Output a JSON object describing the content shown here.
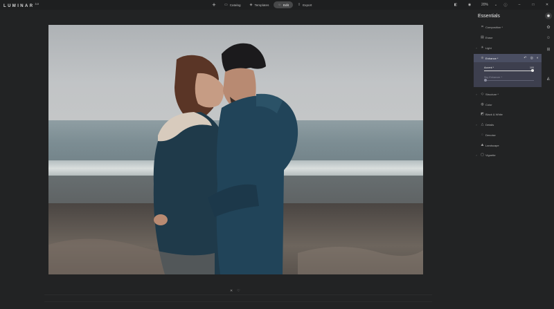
{
  "app": {
    "logo_text": "LUMINAR",
    "logo_version": "3.0"
  },
  "topnav": {
    "add_icon": "plus",
    "items": [
      {
        "label": "Catalog",
        "icon": "catalog-icon"
      },
      {
        "label": "Templates",
        "icon": "templates-icon"
      },
      {
        "label": "Edit",
        "icon": "edit-icon",
        "active": true
      },
      {
        "label": "Export",
        "icon": "export-icon"
      }
    ]
  },
  "topright": {
    "zoom": "20%"
  },
  "bottom": {
    "reject_glyph": "✕",
    "favorite_glyph": "♡"
  },
  "panel": {
    "title": "Essentials",
    "tools": [
      {
        "label": "Composition *",
        "icon": "crop"
      },
      {
        "label": "Erase",
        "icon": "erase"
      },
      {
        "label": "Light",
        "icon": "light"
      },
      {
        "label": "Enhance *",
        "icon": "enhance"
      },
      {
        "label": "Structure *",
        "icon": "structure"
      },
      {
        "label": "Color",
        "icon": "color"
      },
      {
        "label": "Black & White",
        "icon": "bw"
      },
      {
        "label": "Details",
        "icon": "details"
      },
      {
        "label": "Denoise",
        "icon": "denoise"
      },
      {
        "label": "Landscape",
        "icon": "landscape"
      },
      {
        "label": "Vignette",
        "icon": "vignette"
      }
    ],
    "enhance": {
      "accent_label": "Accent *",
      "accent_value": "100",
      "accent_fraction": 1.0,
      "sky_label": "Sky Enhancer *",
      "sky_fraction": 0.0
    }
  },
  "colors": {
    "accent": "#4a4e62",
    "background": "#222324"
  }
}
